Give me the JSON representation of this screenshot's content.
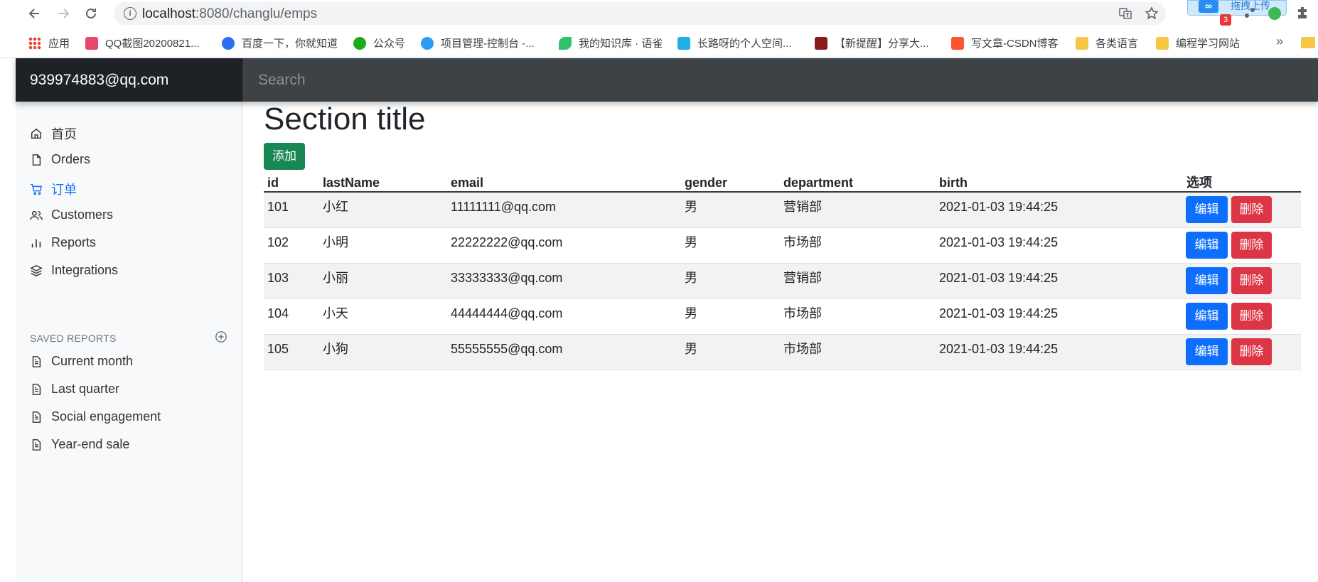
{
  "browser": {
    "url_host": "localhost",
    "url_path": ":8080/changlu/emps",
    "upload_badge": "拖拽上传",
    "ext_count": "3",
    "bookmarks": [
      {
        "label": "应用",
        "color": "#e94235"
      },
      {
        "label": "QQ截图20200821...",
        "color": "#e6486e"
      },
      {
        "label": "百度一下，你就知道",
        "color": "#2b6ff1"
      },
      {
        "label": "公众号",
        "color": "#1aad19"
      },
      {
        "label": "项目管理-控制台 -...",
        "color": "#2a9df4"
      },
      {
        "label": "我的知识库 · 语雀",
        "color": "#31c26a"
      },
      {
        "label": "长路呀的个人空间...",
        "color": "#23ade5"
      },
      {
        "label": "【新提醒】分享大...",
        "color": "#8b1a1a"
      },
      {
        "label": "写文章-CSDN博客",
        "color": "#fc5531"
      },
      {
        "label": "各类语言",
        "color": "#f6c744"
      },
      {
        "label": "编程学习网站",
        "color": "#f6c744"
      }
    ],
    "more_label": "»"
  },
  "topbar": {
    "brand": "939974883@qq.com",
    "search_placeholder": "Search"
  },
  "sidebar": {
    "items": [
      {
        "label": "首页",
        "icon": "home-icon"
      },
      {
        "label": "Orders",
        "icon": "file-icon"
      },
      {
        "label": "订单",
        "icon": "cart-icon"
      },
      {
        "label": "Customers",
        "icon": "users-icon"
      },
      {
        "label": "Reports",
        "icon": "bar-chart-icon"
      },
      {
        "label": "Integrations",
        "icon": "layers-icon"
      }
    ],
    "saved_heading": "SAVED REPORTS",
    "saved": [
      {
        "label": "Current month"
      },
      {
        "label": "Last quarter"
      },
      {
        "label": "Social engagement"
      },
      {
        "label": "Year-end sale"
      }
    ]
  },
  "main": {
    "title": "Section title",
    "add_label": "添加",
    "columns": [
      "id",
      "lastName",
      "email",
      "gender",
      "department",
      "birth",
      "选项"
    ],
    "rows": [
      {
        "id": "101",
        "lastName": "小红",
        "email": "11111111@qq.com",
        "gender": "男",
        "department": "营销部",
        "birth": "2021-01-03 19:44:25"
      },
      {
        "id": "102",
        "lastName": "小明",
        "email": "22222222@qq.com",
        "gender": "男",
        "department": "市场部",
        "birth": "2021-01-03 19:44:25"
      },
      {
        "id": "103",
        "lastName": "小丽",
        "email": "33333333@qq.com",
        "gender": "男",
        "department": "营销部",
        "birth": "2021-01-03 19:44:25"
      },
      {
        "id": "104",
        "lastName": "小天",
        "email": "44444444@qq.com",
        "gender": "男",
        "department": "市场部",
        "birth": "2021-01-03 19:44:25"
      },
      {
        "id": "105",
        "lastName": "小狗",
        "email": "55555555@qq.com",
        "gender": "男",
        "department": "市场部",
        "birth": "2021-01-03 19:44:25"
      }
    ],
    "edit_label": "编辑",
    "delete_label": "删除"
  }
}
